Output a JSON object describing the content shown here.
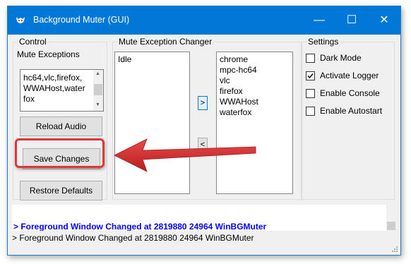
{
  "window": {
    "title": "Background Muter (GUI)",
    "minimize": "—",
    "maximize": "☐",
    "close": "✕"
  },
  "control": {
    "group_label": "Control",
    "mute_exceptions_label": "Mute Exceptions",
    "mute_exceptions_lines": [
      "hc64,vlc,firefox,",
      "WWAHost,water",
      "fox"
    ],
    "reload_label": "Reload Audio",
    "save_label": "Save Changes",
    "restore_label": "Restore Defaults"
  },
  "changer": {
    "group_label": "Mute Exception Changer",
    "left_items": [
      "Idle"
    ],
    "right_items": [
      "chrome",
      "mpc-hc64",
      "vlc",
      "firefox",
      "WWAHost",
      "waterfox"
    ],
    "move_right_label": ">",
    "move_left_label": "<"
  },
  "settings": {
    "group_label": "Settings",
    "dark_mode_label": "Dark Mode",
    "dark_mode_checked": false,
    "logger_label": "Activate Logger",
    "logger_checked": true,
    "console_label": "Enable Console",
    "console_checked": false,
    "autostart_label": "Enable Autostart",
    "autostart_checked": false
  },
  "log": {
    "line": "> Foreground Window Changed at 2819880 24964 WinBGMuter",
    "line_color": "#0000ff"
  },
  "status": {
    "text": "> Foreground Window Changed at 2819880 24964 WinBGMuter"
  },
  "colors": {
    "titlebar": "#0078d7",
    "highlight": "#e3343a",
    "arrow": "#d42c2c"
  }
}
